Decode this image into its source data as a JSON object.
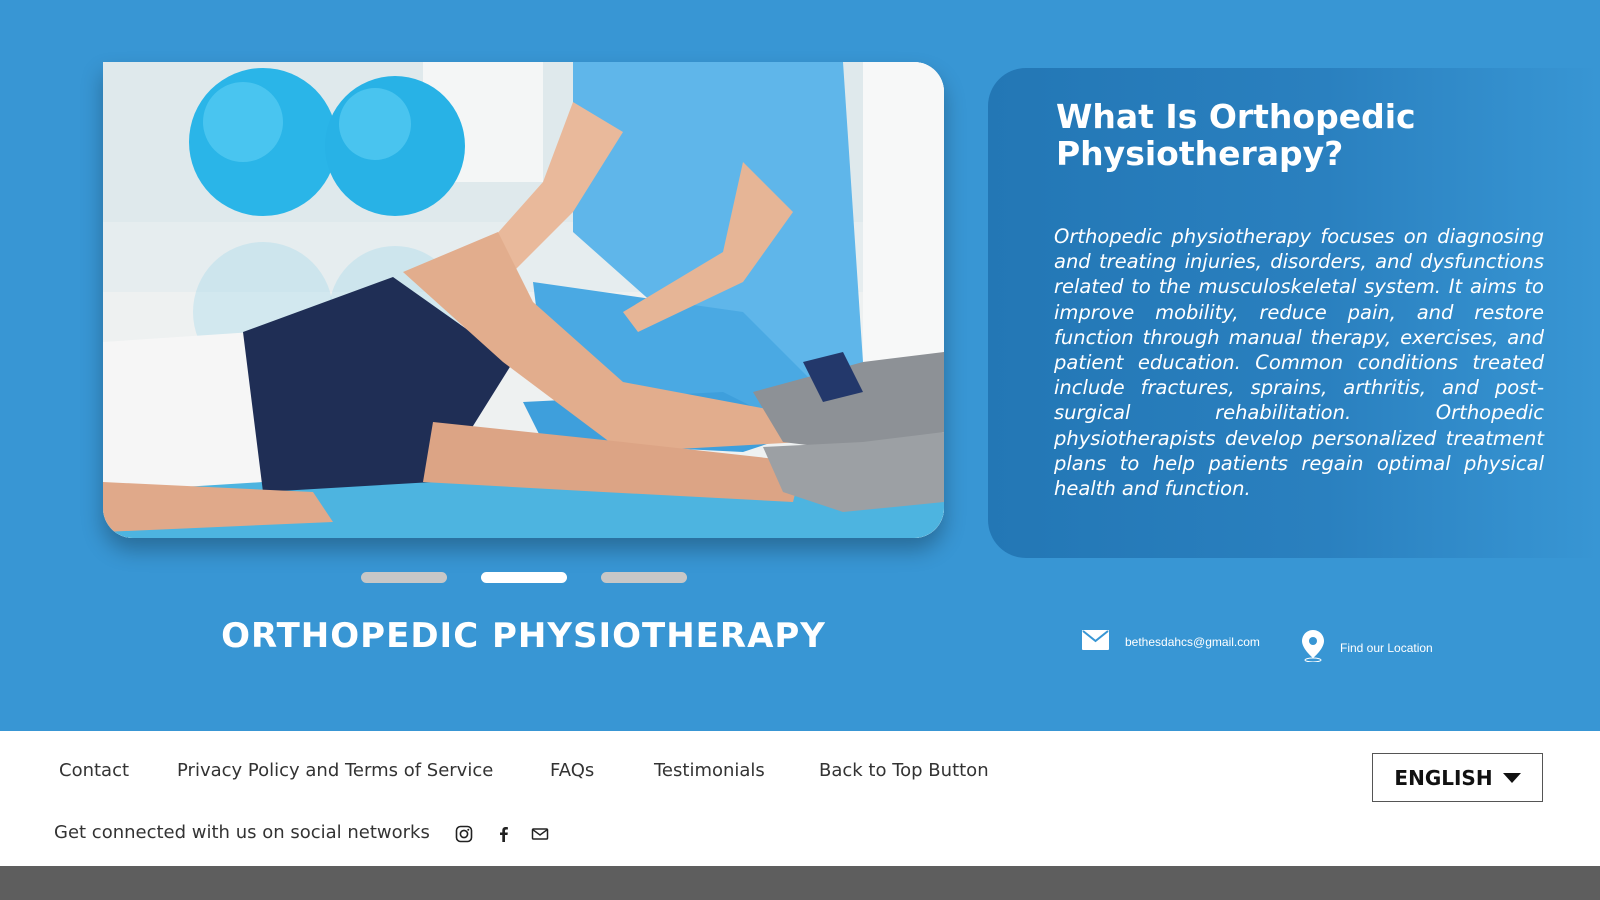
{
  "hero": {
    "carousel": {
      "slides_count": 3,
      "active_index": 1,
      "image_alt": "Physiotherapist examining patient's knee on exercise mat"
    },
    "service_title": "ORTHOPEDIC PHYSIOTHERAPY",
    "info": {
      "title": "What Is Orthopedic Physiotherapy?",
      "description": "Orthopedic physiotherapy focuses on diagnosing and treating injuries, disorders, and dysfunctions related to the musculoskeletal system. It aims to improve mobility, reduce pain, and restore function through manual therapy, exercises, and patient education. Common conditions treated include fractures, sprains, arthritis, and post-surgical rehabilitation. Orthopedic physiotherapists develop personalized treatment plans to help patients regain optimal physical health and function."
    },
    "contact": {
      "email": "bethesdahcs@gmail.com",
      "location_label": "Find our Location",
      "email_icon": "mail-icon",
      "location_icon": "map-pin-icon"
    }
  },
  "footer": {
    "links": [
      {
        "label": "Contact"
      },
      {
        "label": "Privacy Policy and Terms of Service"
      },
      {
        "label": "FAQs"
      },
      {
        "label": "Testimonials"
      },
      {
        "label": "Back to Top Button"
      }
    ],
    "language": "ENGLISH",
    "social_text": "Get connected with us on social networks",
    "social_icons": [
      "instagram-icon",
      "facebook-icon",
      "mail-icon"
    ]
  },
  "colors": {
    "primary_blue": "#3896d4",
    "card_blue": "#2377b5",
    "bottom_bar": "#5e5e5e"
  }
}
